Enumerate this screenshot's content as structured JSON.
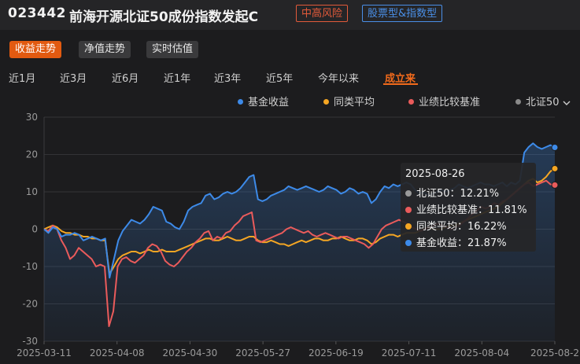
{
  "header": {
    "fund_code": "023442",
    "fund_name": "前海开源北证50成份指数发起C",
    "risk_tag": "中高风险",
    "type_tag": "股票型&指数型"
  },
  "view_buttons": [
    "收益走势",
    "净值走势",
    "实时估值"
  ],
  "periods": [
    "近1月",
    "近3月",
    "近6月",
    "近1年",
    "近3年",
    "近5年",
    "今年以来",
    "成立来"
  ],
  "active_period": "成立来",
  "legend": {
    "fund": "基金收益",
    "peer": "同类平均",
    "benchmark": "业绩比较基准",
    "index": "北证50",
    "index_chevron": "chevron-down-icon"
  },
  "colors": {
    "fund": "#3d8ae8",
    "peer": "#f5a623",
    "benchmark": "#ea5b5b",
    "index": "#8a8a8a",
    "accent": "#f26a1b"
  },
  "tooltip": {
    "date": "2025-08-26",
    "rows": [
      {
        "label": "北证50：12.21%",
        "key": "index"
      },
      {
        "label": "业绩比较基准：11.81%",
        "key": "benchmark"
      },
      {
        "label": "同类平均：16.22%",
        "key": "peer"
      },
      {
        "label": "基金收益：21.87%",
        "key": "fund"
      }
    ]
  },
  "chart_data": {
    "type": "line",
    "x_ticks": [
      "2025-03-11",
      "2025-04-08",
      "2025-04-30",
      "2025-05-27",
      "2025-06-19",
      "2025-07-11",
      "2025-08-04",
      "2025-08-2"
    ],
    "y_ticks": [
      30,
      20,
      10,
      0,
      -10,
      -20,
      -30
    ],
    "ylim": [
      -30,
      30
    ],
    "grid": true,
    "series": [
      {
        "name": "基金收益",
        "key": "fund",
        "area": true,
        "values": [
          0,
          -1,
          0.5,
          0,
          -2,
          -1.5,
          -1.5,
          -1,
          -1.5,
          -3,
          -2.5,
          -2,
          -2.5,
          -3,
          -2.5,
          -13,
          -8,
          -3,
          -0.5,
          1,
          2.5,
          2,
          1.5,
          2.5,
          4,
          6,
          5.5,
          5,
          2,
          1.5,
          0.5,
          0,
          2,
          5,
          6,
          6.5,
          7,
          9,
          9.5,
          8,
          8.5,
          9.5,
          10,
          9.5,
          10,
          11,
          12.5,
          14,
          14.5,
          8,
          7.5,
          8,
          9,
          9.5,
          10,
          10.5,
          11.5,
          11,
          10.5,
          11,
          11.5,
          11,
          10.5,
          10,
          10.5,
          11.5,
          11,
          10.5,
          9.5,
          10,
          11,
          10.5,
          9.5,
          10,
          9.5,
          7,
          8,
          10,
          11.5,
          11,
          12,
          11.5,
          12,
          12.5,
          12,
          10.5,
          9.5,
          10,
          9,
          9.5,
          10,
          10.5,
          10,
          10.5,
          11,
          12,
          11.5,
          11,
          11.5,
          12,
          12.5,
          12,
          12,
          11.5,
          12,
          12.5,
          11.5,
          12.5,
          12,
          13,
          20.5,
          22,
          23,
          22,
          21.5,
          22,
          22.5,
          21.9
        ]
      },
      {
        "name": "同类平均",
        "key": "peer",
        "values": [
          0,
          0.5,
          1,
          0.5,
          -0.5,
          -1,
          -1,
          -1.5,
          -1.5,
          -2,
          -2,
          -2.5,
          -2.5,
          -3,
          -3,
          -12,
          -10,
          -8,
          -7,
          -6.5,
          -6,
          -6,
          -6.5,
          -6,
          -5.5,
          -6,
          -6,
          -5.5,
          -6,
          -6,
          -6,
          -5.5,
          -5,
          -4.5,
          -4,
          -3.5,
          -3,
          -2.5,
          -2.5,
          -3,
          -3,
          -2.5,
          -2,
          -2.5,
          -3,
          -3,
          -2.5,
          -2,
          -2,
          -3,
          -3.5,
          -3.5,
          -3,
          -3.5,
          -4,
          -4,
          -4.5,
          -4,
          -3.5,
          -3,
          -3.5,
          -3,
          -2.5,
          -2.5,
          -3,
          -3,
          -2.5,
          -2.5,
          -2,
          -2.5,
          -3,
          -3,
          -2.5,
          -2.5,
          -3,
          -4,
          -3.5,
          -2.5,
          -2,
          -1.5,
          -1.5,
          -2,
          -1.5,
          -1,
          -1,
          -1,
          -0.5,
          0,
          0.5,
          0,
          0,
          0,
          0.5,
          1,
          1,
          1.5,
          2,
          2.5,
          3,
          3.5,
          4,
          4.5,
          5,
          5.5,
          6,
          7,
          8,
          9,
          10,
          11,
          12,
          13,
          13.5,
          12.5,
          13,
          14,
          15.5,
          16.22
        ]
      },
      {
        "name": "业绩比较基准",
        "key": "benchmark",
        "values": [
          0,
          -0.5,
          1,
          0,
          -3,
          -5,
          -8,
          -7,
          -5,
          -6,
          -7,
          -8,
          -10,
          -9.5,
          -10,
          -26,
          -22,
          -10,
          -8,
          -7.5,
          -8.5,
          -9,
          -8,
          -7,
          -5,
          -4,
          -4.5,
          -6,
          -8.5,
          -9.5,
          -10,
          -9,
          -7.5,
          -6,
          -5,
          -3.5,
          -2.5,
          -1,
          -0.5,
          -3,
          -2,
          -2.5,
          -1,
          -0.5,
          1,
          2,
          3.5,
          4,
          4.5,
          -3,
          -3.5,
          -3,
          -2.5,
          -2,
          -1.5,
          -1,
          0,
          0.5,
          0,
          -0.5,
          -1,
          -0.5,
          -1.5,
          -2,
          -1.5,
          -1,
          -1.5,
          -2,
          -2.5,
          -2,
          -2,
          -2.5,
          -3,
          -3.5,
          -4,
          -5,
          -4,
          -2,
          0,
          1,
          1.5,
          2,
          2.5,
          2,
          1.5,
          0.5,
          0,
          -0.5,
          0,
          0.5,
          1,
          1.5,
          1,
          0.5,
          0,
          0.5,
          1,
          2,
          3,
          4,
          5,
          6,
          5.5,
          6,
          7,
          6.5,
          7.5,
          8,
          9,
          10,
          11,
          12,
          12.5,
          11.5,
          12,
          12.5,
          13,
          12,
          11.81
        ]
      },
      {
        "name": "北证50",
        "key": "index",
        "hidden": true,
        "values": [
          0,
          12.21
        ]
      }
    ]
  }
}
